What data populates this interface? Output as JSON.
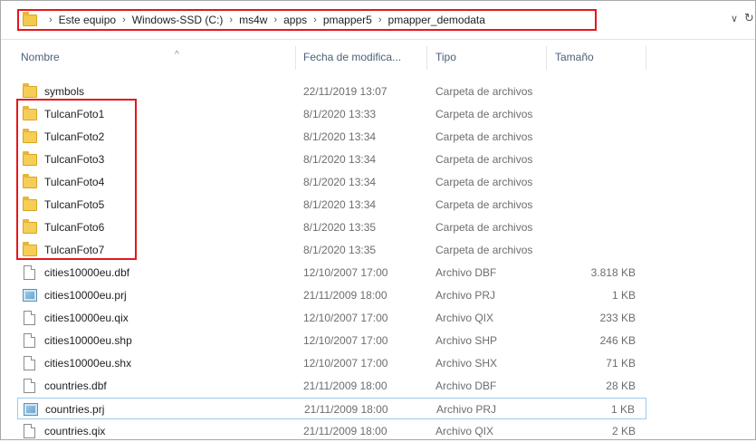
{
  "address": {
    "crumbs": [
      "Este equipo",
      "Windows-SSD (C:)",
      "ms4w",
      "apps",
      "pmapper5",
      "pmapper_demodata"
    ],
    "separator": "›",
    "dropdown_glyph": "∨",
    "refresh_glyph": "↻"
  },
  "columns": {
    "name": "Nombre",
    "date": "Fecha de modifica...",
    "type": "Tipo",
    "size": "Tamaño",
    "sort_glyph": "^"
  },
  "files": [
    {
      "name": "symbols",
      "date": "22/11/2019 13:07",
      "type": "Carpeta de archivos",
      "size": "",
      "icon": "folder-icon"
    },
    {
      "name": "TulcanFoto1",
      "date": "8/1/2020 13:33",
      "type": "Carpeta de archivos",
      "size": "",
      "icon": "folder-icon"
    },
    {
      "name": "TulcanFoto2",
      "date": "8/1/2020 13:34",
      "type": "Carpeta de archivos",
      "size": "",
      "icon": "folder-icon"
    },
    {
      "name": "TulcanFoto3",
      "date": "8/1/2020 13:34",
      "type": "Carpeta de archivos",
      "size": "",
      "icon": "folder-icon"
    },
    {
      "name": "TulcanFoto4",
      "date": "8/1/2020 13:34",
      "type": "Carpeta de archivos",
      "size": "",
      "icon": "folder-icon"
    },
    {
      "name": "TulcanFoto5",
      "date": "8/1/2020 13:34",
      "type": "Carpeta de archivos",
      "size": "",
      "icon": "folder-icon"
    },
    {
      "name": "TulcanFoto6",
      "date": "8/1/2020 13:35",
      "type": "Carpeta de archivos",
      "size": "",
      "icon": "folder-icon"
    },
    {
      "name": "TulcanFoto7",
      "date": "8/1/2020 13:35",
      "type": "Carpeta de archivos",
      "size": "",
      "icon": "folder-icon"
    },
    {
      "name": "cities10000eu.dbf",
      "date": "12/10/2007 17:00",
      "type": "Archivo DBF",
      "size": "3.818 KB",
      "icon": "file-icon"
    },
    {
      "name": "cities10000eu.prj",
      "date": "21/11/2009 18:00",
      "type": "Archivo PRJ",
      "size": "1 KB",
      "icon": "prj-file-icon"
    },
    {
      "name": "cities10000eu.qix",
      "date": "12/10/2007 17:00",
      "type": "Archivo QIX",
      "size": "233 KB",
      "icon": "file-icon"
    },
    {
      "name": "cities10000eu.shp",
      "date": "12/10/2007 17:00",
      "type": "Archivo SHP",
      "size": "246 KB",
      "icon": "file-icon"
    },
    {
      "name": "cities10000eu.shx",
      "date": "12/10/2007 17:00",
      "type": "Archivo SHX",
      "size": "71 KB",
      "icon": "file-icon"
    },
    {
      "name": "countries.dbf",
      "date": "21/11/2009 18:00",
      "type": "Archivo DBF",
      "size": "28 KB",
      "icon": "file-icon"
    },
    {
      "name": "countries.prj",
      "date": "21/11/2009 18:00",
      "type": "Archivo PRJ",
      "size": "1 KB",
      "icon": "prj-file-icon",
      "selected": true
    },
    {
      "name": "countries.qix",
      "date": "21/11/2009 18:00",
      "type": "Archivo QIX",
      "size": "2 KB",
      "icon": "file-icon"
    }
  ],
  "colors": {
    "highlight": "#e8151b",
    "header_text": "#4c607a",
    "selection_border": "#99c9ef"
  }
}
